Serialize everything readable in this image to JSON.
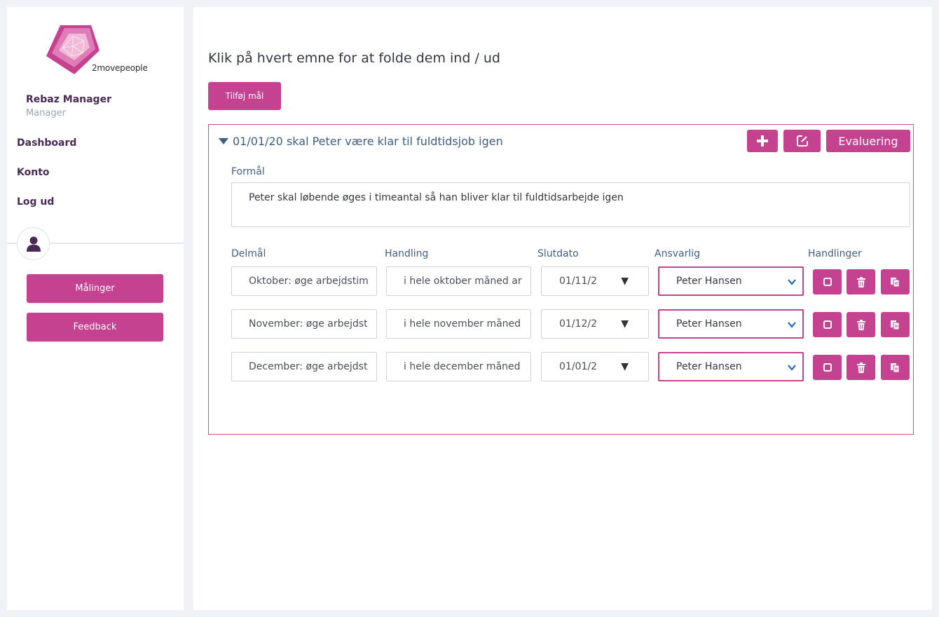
{
  "brand": {
    "name": "2movepeople",
    "accent": "#c4428f",
    "text_dark": "#4a2a55",
    "text_blue": "#3f5e80"
  },
  "user": {
    "name": "Rebaz Manager",
    "role": "Manager"
  },
  "nav": {
    "items": [
      "Dashboard",
      "Konto",
      "Log ud"
    ]
  },
  "sidebar_buttons": {
    "measurements": "Målinger",
    "feedback": "Feedback"
  },
  "main": {
    "heading": "Klik på hvert emne for at folde dem ind / ud",
    "add_goal_label": "Tilføj mål",
    "goal": {
      "title": "01/01/20 skal Peter være klar til fuldtidsjob igen",
      "evaluation_label": "Evaluering",
      "purpose_label": "Formål",
      "purpose_text": "Peter skal løbende øges i timeantal så han bliver klar til fuldtidsarbejde igen",
      "columns": {
        "subgoal": "Delmål",
        "action": "Handling",
        "end_date": "Slutdato",
        "responsible": "Ansvarlig",
        "actions": "Handlinger"
      },
      "rows": [
        {
          "subgoal": "Oktober: øge arbejdstim",
          "action": "i hele oktober måned ar",
          "end_date": "01/11/2",
          "responsible": "Peter Hansen"
        },
        {
          "subgoal": "November: øge arbejdst",
          "action": "i hele november måned",
          "end_date": "01/12/2",
          "responsible": "Peter Hansen"
        },
        {
          "subgoal": "December: øge arbejdst",
          "action": "i hele december måned",
          "end_date": "01/01/2",
          "responsible": "Peter Hansen"
        }
      ]
    }
  },
  "icons": [
    "plus-icon",
    "edit-icon",
    "square-icon",
    "trash-icon",
    "copy-icon",
    "user-icon",
    "caret-down-icon",
    "chevron-down-icon"
  ]
}
